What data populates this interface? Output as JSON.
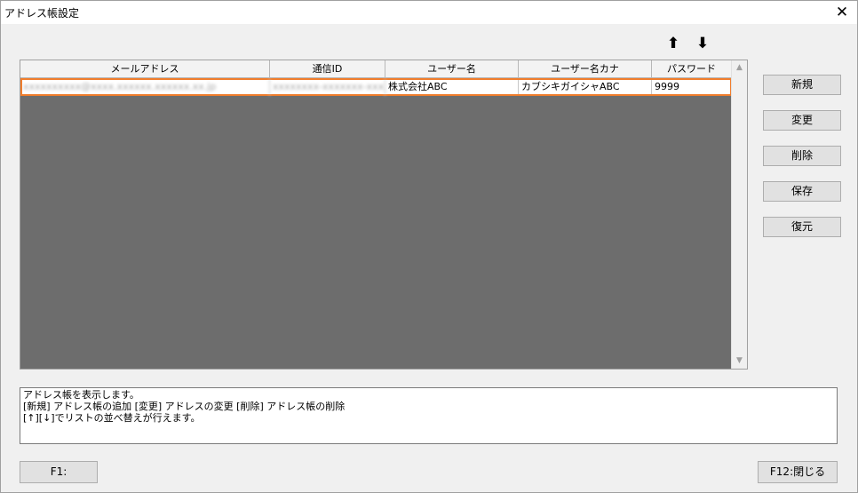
{
  "window": {
    "title": "アドレス帳設定",
    "close_glyph": "✕"
  },
  "arrows": {
    "up": "⬆",
    "down": "⬇"
  },
  "table": {
    "columns": [
      "メールアドレス",
      "通信ID",
      "ユーザー名",
      "ユーザー名カナ",
      "パスワード"
    ],
    "rows": [
      {
        "email": "xxxxxxxxxx@xxxx.xxxxxx.xxxxxx.xx.jp",
        "comm_id": "xxxxxxxx-xxxxxxx-xxxx",
        "user_name": "株式会社ABC",
        "user_kana": "カブシキガイシャABC",
        "password": "9999"
      }
    ]
  },
  "buttons": {
    "new": "新規",
    "change": "変更",
    "delete": "削除",
    "save": "保存",
    "restore": "復元"
  },
  "message": {
    "lines": [
      "アドレス帳を表示します。",
      "[新規] アドレス帳の追加 [変更] アドレスの変更 [削除] アドレス帳の削除",
      "[↑][↓]でリストの並べ替えが行えます。"
    ]
  },
  "footer": {
    "f1": "F1:",
    "f12": "F12:閉じる"
  }
}
